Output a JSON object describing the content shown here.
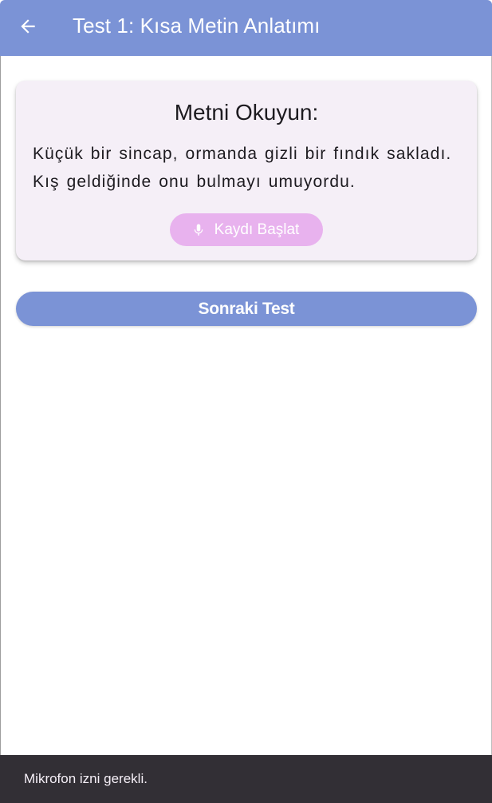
{
  "app_bar": {
    "title": "Test 1: Kısa Metin Anlatımı",
    "back_icon": "arrow-back-icon",
    "background_color": "#7b93d6"
  },
  "card": {
    "title": "Metni Okuyun:",
    "text_lines": [
      "Küçük bir sincap, ormanda gizli bir fındık sakladı.",
      "Kış geldiğinde onu bulmayı umuyordu."
    ],
    "background_color": "#f5eff7",
    "record_button": {
      "label": "Kaydı Başlat",
      "icon": "microphone-icon",
      "color": "#e8b2ee",
      "state": "disabled"
    }
  },
  "next_button": {
    "label": "Sonraki Test",
    "color": "#7b93d6"
  },
  "snackbar": {
    "message": "Mikrofon izni gerekli.",
    "background_color": "#322f35"
  }
}
